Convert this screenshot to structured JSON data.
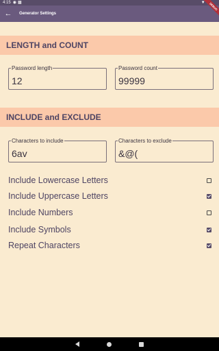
{
  "status_bar": {
    "time": "4:15",
    "icons": [
      "notification-icon",
      "sim-icon",
      "wifi-icon",
      "battery-icon"
    ]
  },
  "app_bar": {
    "title": "Generator Settings",
    "back_icon": "arrow-back-icon"
  },
  "sections": {
    "length_count": "LENGTH and COUNT",
    "include_exclude": "INCLUDE and EXCLUDE"
  },
  "fields": {
    "password_length": {
      "label": "Password length",
      "value": "12"
    },
    "password_count": {
      "label": "Password count",
      "value": "99999"
    },
    "chars_include": {
      "label": "Characters to include",
      "value": "6av"
    },
    "chars_exclude": {
      "label": "Characters to exclude",
      "value": "&@("
    }
  },
  "options": [
    {
      "label": "Include Lowercase Letters",
      "checked": false
    },
    {
      "label": "Include Uppercase Letters",
      "checked": true
    },
    {
      "label": "Include Numbers",
      "checked": false
    },
    {
      "label": "Include Symbols",
      "checked": true
    },
    {
      "label": "Repeat Characters",
      "checked": true
    }
  ],
  "colors": {
    "background": "#faebd0",
    "app_bar": "#6a5a7e",
    "section_header": "#fbc9aa",
    "accent_text": "#4e4463"
  }
}
